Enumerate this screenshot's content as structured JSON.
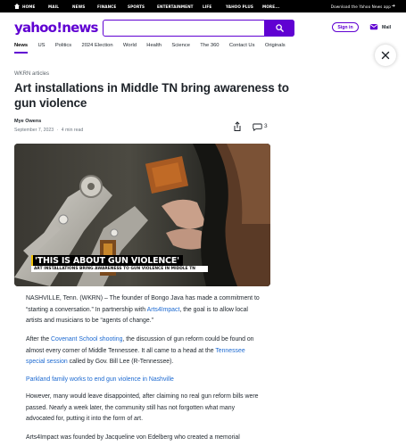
{
  "topbar": {
    "items": [
      "HOME",
      "MAIL",
      "NEWS",
      "FINANCE",
      "SPORTS",
      "ENTERTAINMENT",
      "LIFE",
      "YAHOO PLUS",
      "MORE..."
    ],
    "download_text": "Download the Yahoo News app"
  },
  "header": {
    "logo": "yahoo!news",
    "search_placeholder": "",
    "signin_label": "Sign in",
    "mail_label": "Mail"
  },
  "nav": {
    "items": [
      "News",
      "US",
      "Politics",
      "2024 Election",
      "World",
      "Health",
      "Science",
      "The 360",
      "Contact Us",
      "Originals"
    ],
    "active": "News"
  },
  "article": {
    "kicker": "WKRN articles",
    "headline": "Art installations in Middle TN bring awareness to gun violence",
    "author": "Mye Owens",
    "date": "September 7, 2023",
    "separator": "·",
    "read_time": "4 min read",
    "comment_count": "3",
    "hero": {
      "banner_main": "'THIS IS ABOUT GUN VIOLENCE'",
      "banner_sub": "ART INSTALLATIONS BRING AWARENESS TO GUN VIOLENCE IN MIDDLE TN"
    },
    "p1": {
      "a": "NASHVILLE, Tenn. (WKRN) – The founder of Bongo Java has made a commitment to “starting a conversation.” In partnership with ",
      "link": "Arts4Impact",
      "b": ", the goal is to allow local artists and musicians to be “agents of change.”"
    },
    "p2": {
      "a": "After the ",
      "link1": "Covenant School shooting",
      "b": ", the discussion of gun reform could be found on almost every corner of Middle Tennessee. It all came to a head at the ",
      "link2": "Tennessee special session",
      "c": " called by Gov. Bill Lee (R-Tennessee)."
    },
    "p3_link": "Parkland family works to end gun violence in Nashville",
    "p4": "However, many would leave disappointed, after claiming no real gun reform bills were passed. Nearly a week later, the community still has not forgotten what many advocated for, putting it into the form of art.",
    "p5": "Arts4Impact was founded by Jacqueline von Edelberg who created a memorial"
  },
  "colors": {
    "brand": "#6001d2",
    "link": "#1d6ad1",
    "banner_accent": "#f2c200"
  }
}
